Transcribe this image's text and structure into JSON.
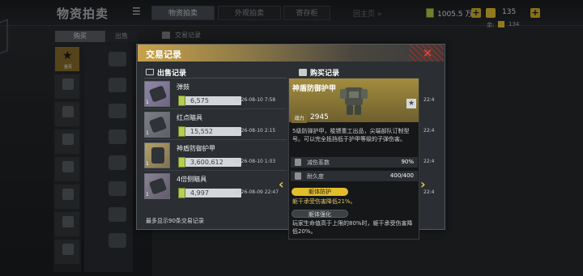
{
  "app": {
    "title": "物资拍卖",
    "tabs": [
      "物资拍卖",
      "外观拍卖",
      "寄存柜"
    ],
    "back_lobby": "回主页 »",
    "currency": {
      "money": "1005.5 万",
      "coupons": "135",
      "sub_label": "余:",
      "sub_value": "134"
    },
    "side_tabs": {
      "buy": "购买",
      "sell": "出售"
    },
    "categories": [
      "首页",
      "",
      "",
      "",
      "",
      "",
      "",
      "",
      ""
    ],
    "mid_items": [
      "",
      "",
      "",
      "",
      "",
      "",
      "",
      "",
      ""
    ],
    "right_header": "交易记录",
    "colors": {
      "accent_gold": "#c7a24a",
      "close_red": "#e04a3a",
      "price_green": "#b8cc56"
    }
  },
  "modal": {
    "title": "交易记录",
    "close_icon": "close-x",
    "sell_header": "出售记录",
    "buy_header": "购买记录",
    "sell_records": [
      {
        "name": "弹鼓",
        "price": "6,575",
        "date": "2026-08-10 7:58",
        "qty": "1"
      },
      {
        "name": "红点瞄具",
        "price": "15,552",
        "date": "2026-08-10 2:15",
        "qty": "1"
      },
      {
        "name": "神盾防御护甲",
        "price": "3,600,612",
        "date": "2026-08-10 1:03",
        "qty": "1"
      },
      {
        "name": "4倍侧瞄具",
        "price": "4,997",
        "date": "2026-08-09 22:47",
        "qty": "1"
      }
    ],
    "buy_dates": [
      "22:4",
      "22:4",
      "22:4",
      "22:4"
    ],
    "footer": "最多显示90条交易记录"
  },
  "tooltip": {
    "name": "神盾防御护甲",
    "power_label": "战力",
    "power_value": "2945",
    "description": "5级防弹护甲，梭镖重工出品，尖端部队订制型号。可以完全抵挡低于护甲等级的子弹伤害。",
    "stats": [
      {
        "label": "减伤系数",
        "value": "90%"
      },
      {
        "label": "耐久度",
        "value": "400/400"
      }
    ],
    "perks": [
      {
        "tag": "躯体防护",
        "desc": "躯干承受伤害降低21%。"
      },
      {
        "tag": "躯体强化",
        "desc": "玩家生命值高于上限的80%时，躯干承受伤害降低20%。"
      }
    ]
  }
}
